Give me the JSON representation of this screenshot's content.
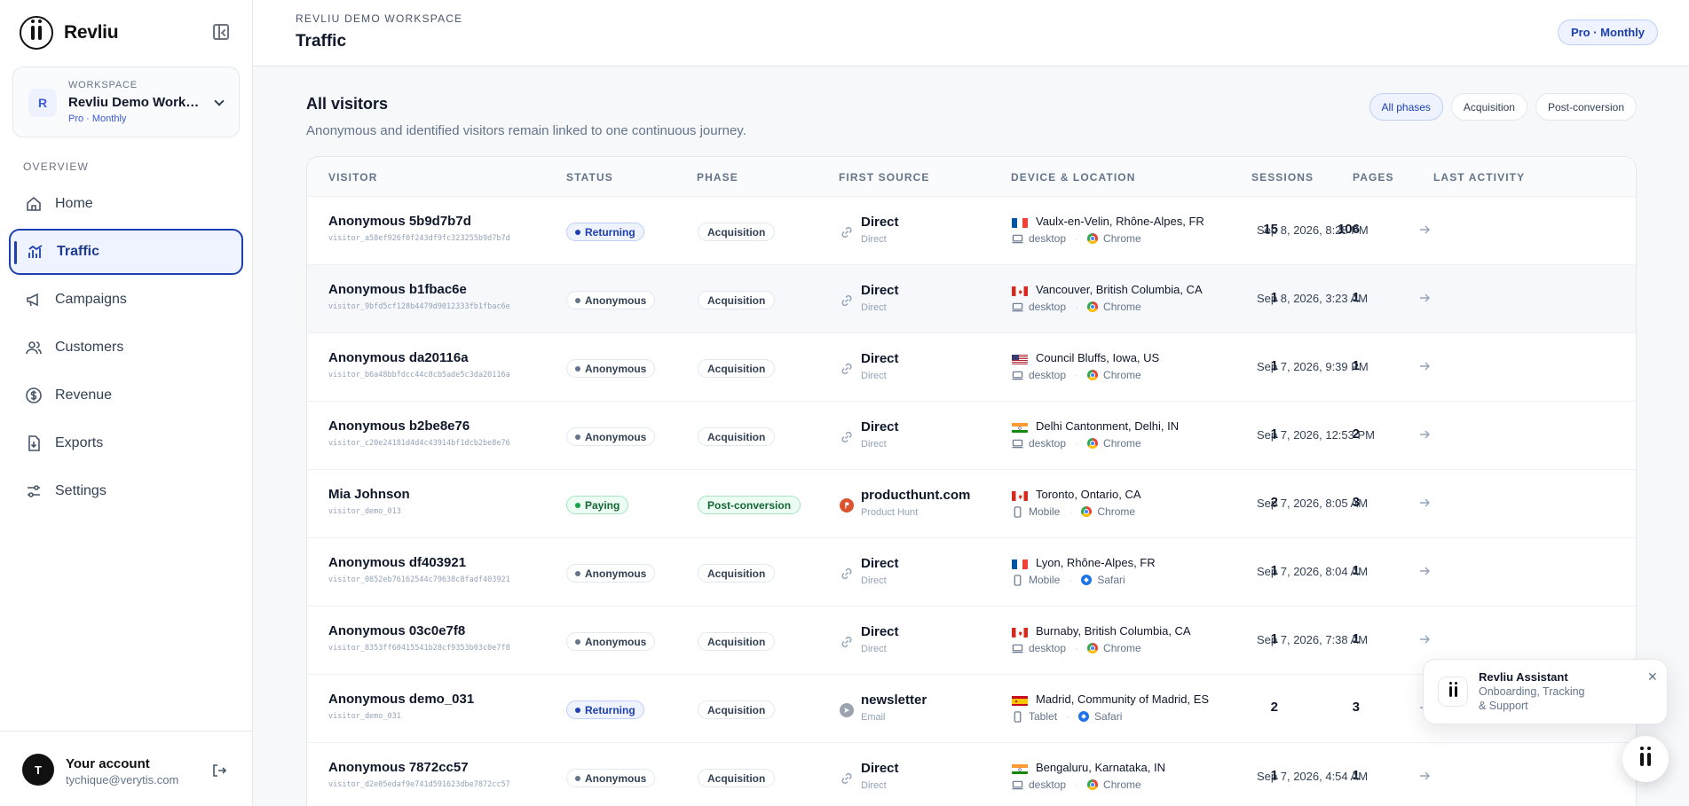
{
  "app": {
    "name": "Revliu"
  },
  "workspace": {
    "label": "WORKSPACE",
    "name": "Revliu Demo Workspace",
    "plan": "Pro · Monthly",
    "initial": "R"
  },
  "nav": {
    "section": "OVERVIEW",
    "items": [
      {
        "label": "Home",
        "icon": "home-icon"
      },
      {
        "label": "Traffic",
        "icon": "chart-icon",
        "active": true
      },
      {
        "label": "Campaigns",
        "icon": "megaphone-icon"
      },
      {
        "label": "Customers",
        "icon": "users-icon"
      },
      {
        "label": "Revenue",
        "icon": "dollar-icon"
      },
      {
        "label": "Exports",
        "icon": "export-icon"
      },
      {
        "label": "Settings",
        "icon": "sliders-icon"
      }
    ]
  },
  "account": {
    "initial": "T",
    "name": "Your account",
    "email": "tychique@verytis.com"
  },
  "header": {
    "caption": "REVLIU DEMO WORKSPACE",
    "title": "Traffic",
    "plan_pill": "Pro · Monthly"
  },
  "section": {
    "title": "All visitors",
    "subtitle": "Anonymous and identified visitors remain linked to one continuous journey."
  },
  "filters": [
    {
      "label": "All phases",
      "active": true
    },
    {
      "label": "Acquisition",
      "active": false
    },
    {
      "label": "Post-conversion",
      "active": false
    }
  ],
  "columns": [
    "VISITOR",
    "STATUS",
    "PHASE",
    "FIRST SOURCE",
    "DEVICE & LOCATION",
    "SESSIONS",
    "PAGES",
    "LAST ACTIVITY"
  ],
  "rows": [
    {
      "name": "Anonymous 5b9d7b7d",
      "id": "visitor_a58ef926f0f243df9fc323255b9d7b7d",
      "status": "Returning",
      "phase": "Acquisition",
      "source": "Direct",
      "source_sub": "Direct",
      "flag": "fr",
      "location": "Vaulx-en-Velin, Rhône-Alpes, FR",
      "device": "desktop",
      "browser": "Chrome",
      "sessions": "15",
      "pages": "106",
      "last": "Sep 8, 2026, 8:28 PM"
    },
    {
      "name": "Anonymous b1fbac6e",
      "id": "visitor_9bfd5cf128b4479d9012333fb1fbac6e",
      "status": "Anonymous",
      "phase": "Acquisition",
      "source": "Direct",
      "source_sub": "Direct",
      "flag": "ca",
      "location": "Vancouver, British Columbia, CA",
      "device": "desktop",
      "browser": "Chrome",
      "sessions": "1",
      "pages": "1",
      "last": "Sep 8, 2026, 3:23 AM"
    },
    {
      "name": "Anonymous da20116a",
      "id": "visitor_b6a48bbfdcc44c8cb5ade5c3da20116a",
      "status": "Anonymous",
      "phase": "Acquisition",
      "source": "Direct",
      "source_sub": "Direct",
      "flag": "us",
      "location": "Council Bluffs, Iowa, US",
      "device": "desktop",
      "browser": "Chrome",
      "sessions": "1",
      "pages": "1",
      "last": "Sep 7, 2026, 9:39 PM"
    },
    {
      "name": "Anonymous b2be8e76",
      "id": "visitor_c20e24181d4d4c43914bf1dcb2be8e76",
      "status": "Anonymous",
      "phase": "Acquisition",
      "source": "Direct",
      "source_sub": "Direct",
      "flag": "in",
      "location": "Delhi Cantonment, Delhi, IN",
      "device": "desktop",
      "browser": "Chrome",
      "sessions": "1",
      "pages": "2",
      "last": "Sep 7, 2026, 12:53 PM"
    },
    {
      "name": "Mia Johnson",
      "id": "visitor_demo_013",
      "status": "Paying",
      "phase": "Post-conversion",
      "source": "producthunt.com",
      "source_sub": "Product Hunt",
      "flag": "ca",
      "location": "Toronto, Ontario, CA",
      "device": "Mobile",
      "browser": "Chrome",
      "sessions": "2",
      "pages": "3",
      "last": "Sep 7, 2026, 8:05 AM"
    },
    {
      "name": "Anonymous df403921",
      "id": "visitor_0852eb76162544c79638c8fadf403921",
      "status": "Anonymous",
      "phase": "Acquisition",
      "source": "Direct",
      "source_sub": "Direct",
      "flag": "fr",
      "location": "Lyon, Rhône-Alpes, FR",
      "device": "Mobile",
      "browser": "Safari",
      "sessions": "1",
      "pages": "1",
      "last": "Sep 7, 2026, 8:04 AM"
    },
    {
      "name": "Anonymous 03c0e7f8",
      "id": "visitor_8353ff60415541b28cf9353b03c0e7f8",
      "status": "Anonymous",
      "phase": "Acquisition",
      "source": "Direct",
      "source_sub": "Direct",
      "flag": "ca",
      "location": "Burnaby, British Columbia, CA",
      "device": "desktop",
      "browser": "Chrome",
      "sessions": "1",
      "pages": "1",
      "last": "Sep 7, 2026, 7:38 AM"
    },
    {
      "name": "Anonymous demo_031",
      "id": "visitor_demo_031",
      "status": "Returning",
      "phase": "Acquisition",
      "source": "newsletter",
      "source_sub": "Email",
      "flag": "es",
      "location": "Madrid, Community of Madrid, ES",
      "device": "Tablet",
      "browser": "Safari",
      "sessions": "2",
      "pages": "3",
      "last": ""
    },
    {
      "name": "Anonymous 7872cc57",
      "id": "visitor_d2e05edaf9e741d591623dbe7872cc57",
      "status": "Anonymous",
      "phase": "Acquisition",
      "source": "Direct",
      "source_sub": "Direct",
      "flag": "in",
      "location": "Bengaluru, Karnataka, IN",
      "device": "desktop",
      "browser": "Chrome",
      "sessions": "1",
      "pages": "1",
      "last": "Sep 7, 2026, 4:54 AM"
    }
  ],
  "assistant": {
    "title": "Revliu Assistant",
    "subtitle": "Onboarding, Tracking & Support",
    "close": "✕"
  },
  "colors": {
    "accent": "#1e40af",
    "paying": "#16a34a",
    "sidebar_bg": "#ffffff",
    "page_bg": "#f7f8fa"
  }
}
